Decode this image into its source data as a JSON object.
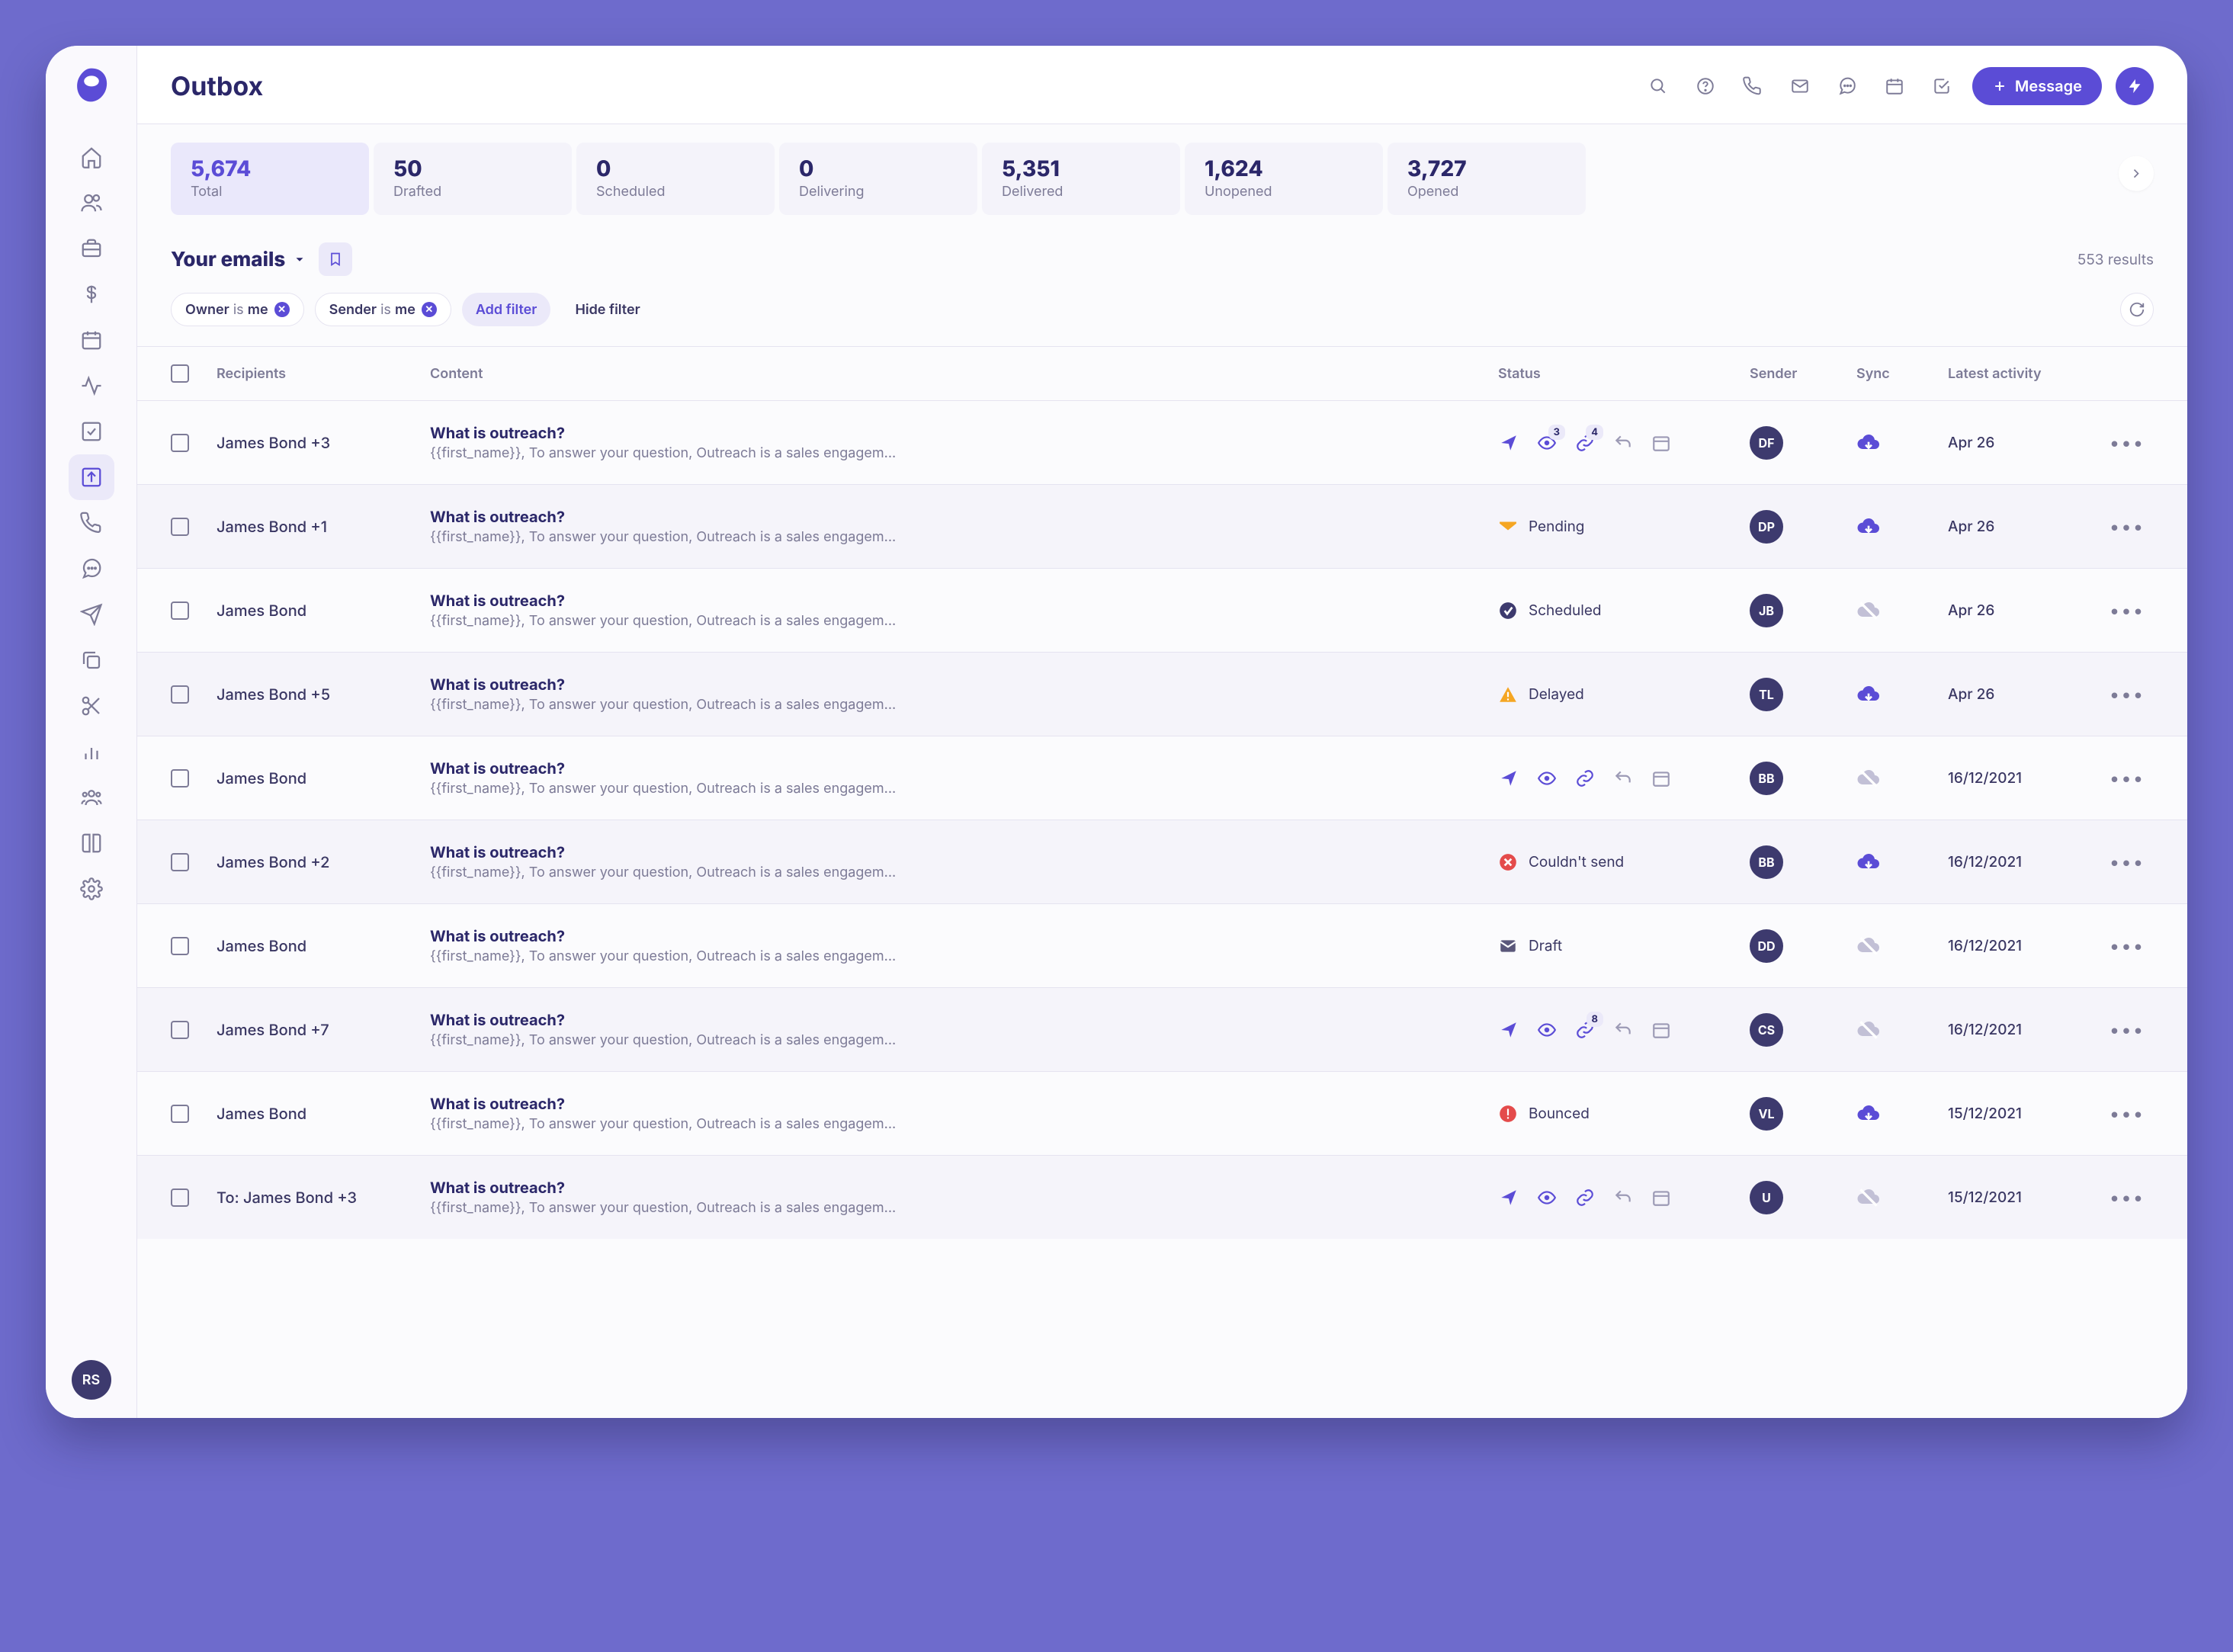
{
  "header": {
    "title": "Outbox",
    "message_btn": "Message"
  },
  "user_badge": "RS",
  "stats": [
    {
      "value": "5,674",
      "label": "Total",
      "active": true
    },
    {
      "value": "50",
      "label": "Drafted",
      "active": false
    },
    {
      "value": "0",
      "label": "Scheduled",
      "active": false
    },
    {
      "value": "0",
      "label": "Delivering",
      "active": false
    },
    {
      "value": "5,351",
      "label": "Delivered",
      "active": false
    },
    {
      "value": "1,624",
      "label": "Unopened",
      "active": false
    },
    {
      "value": "3,727",
      "label": "Opened",
      "active": false
    }
  ],
  "filters": {
    "title": "Your emails",
    "results": "553 results",
    "chips": [
      {
        "field": "Owner",
        "op": "is",
        "val": "me"
      },
      {
        "field": "Sender",
        "op": "is",
        "val": "me"
      }
    ],
    "add_label": "Add filter",
    "hide_label": "Hide filter"
  },
  "columns": {
    "recipients": "Recipients",
    "content": "Content",
    "status": "Status",
    "sender": "Sender",
    "sync": "Sync",
    "latest": "Latest activity"
  },
  "content_preview": "{{first_name}}, To answer your question, Outreach is a sales engagem...",
  "subject": "What is outreach?",
  "rows": [
    {
      "recipient": "James Bond +3",
      "status_type": "icons",
      "eye_badge": "3",
      "link_badge": "4",
      "sender": "DF",
      "sync": "cloud",
      "latest": "Apr 26"
    },
    {
      "recipient": "James Bond +1",
      "status_type": "pending",
      "status_label": "Pending",
      "sender": "DP",
      "sync": "cloud",
      "latest": "Apr 26"
    },
    {
      "recipient": "James Bond",
      "status_type": "scheduled",
      "status_label": "Scheduled",
      "sender": "JB",
      "sync": "off",
      "latest": "Apr 26"
    },
    {
      "recipient": "James Bond +5",
      "status_type": "delayed",
      "status_label": "Delayed",
      "sender": "TL",
      "sync": "cloud",
      "latest": "Apr 26"
    },
    {
      "recipient": "James Bond",
      "status_type": "icons",
      "eye_badge": "",
      "link_badge": "",
      "sender": "BB",
      "sync": "off",
      "latest": "16/12/2021"
    },
    {
      "recipient": "James Bond +2",
      "status_type": "failed",
      "status_label": "Couldn't send",
      "sender": "BB",
      "sync": "cloud",
      "latest": "16/12/2021"
    },
    {
      "recipient": "James Bond",
      "status_type": "draft",
      "status_label": "Draft",
      "sender": "DD",
      "sync": "off",
      "latest": "16/12/2021"
    },
    {
      "recipient": "James Bond +7",
      "status_type": "icons",
      "eye_badge": "",
      "link_badge": "8",
      "sender": "CS",
      "sync": "off",
      "latest": "16/12/2021"
    },
    {
      "recipient": "James Bond",
      "status_type": "bounced",
      "status_label": "Bounced",
      "sender": "VL",
      "sync": "cloud",
      "latest": "15/12/2021"
    },
    {
      "recipient": "To: James Bond +3",
      "status_type": "icons",
      "eye_badge": "",
      "link_badge": "",
      "sender": "U",
      "sync": "off",
      "latest": "15/12/2021"
    }
  ],
  "sidebar_icons": [
    "home",
    "people",
    "briefcase",
    "dollar",
    "calendar",
    "activity",
    "check-square",
    "outbox",
    "phone",
    "chat",
    "send",
    "copy",
    "scissors",
    "chart",
    "team",
    "book",
    "settings"
  ],
  "sidebar_active": "outbox"
}
